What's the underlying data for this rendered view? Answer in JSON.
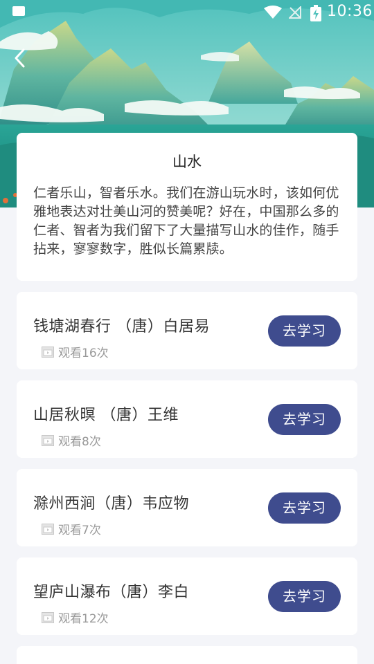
{
  "status_bar": {
    "time": "10:36"
  },
  "intro": {
    "title": "山水",
    "text": "仁者乐山，智者乐水。我们在游山玩水时，该如何优雅地表达对壮美山河的赞美呢？好在，中国那么多的仁者、智者为我们留下了大量描写山水的佳作，随手拈来，寥寥数字，胜似长篇累牍。"
  },
  "items": [
    {
      "title": "钱塘湖春行 （唐）白居易",
      "views": "观看16次",
      "button": "去学习"
    },
    {
      "title": "山居秋暝 （唐）王维",
      "views": "观看8次",
      "button": "去学习"
    },
    {
      "title": "滁州西涧（唐）韦应物",
      "views": "观看7次",
      "button": "去学习"
    },
    {
      "title": "望庐山瀑布（唐）李白",
      "views": "观看12次",
      "button": "去学习"
    }
  ],
  "colors": {
    "accent": "#3f4c8e",
    "hero_sky": "#5cc7c0"
  }
}
